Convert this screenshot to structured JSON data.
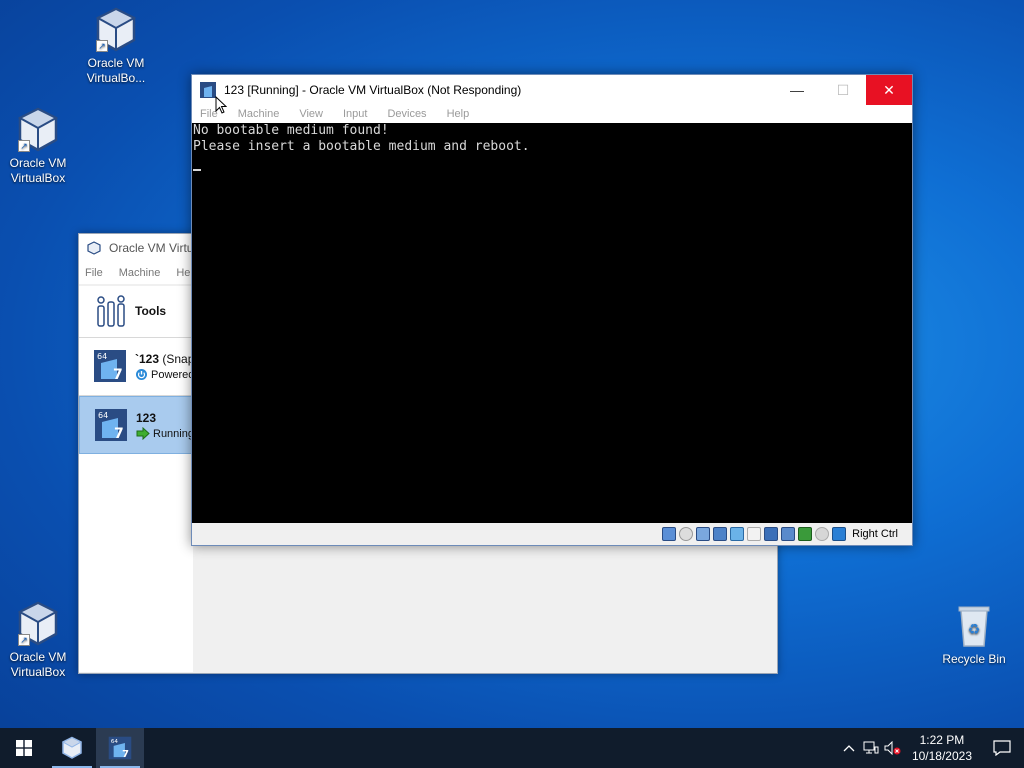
{
  "desktop": {
    "icons": [
      {
        "label": "Oracle VM VirtualBo..."
      },
      {
        "label": "Oracle VM VirtualBox"
      },
      {
        "label": "Oracle VM VirtualBox"
      },
      {
        "label": "Recycle Bin"
      }
    ]
  },
  "manager": {
    "title": "Oracle VM Virtu",
    "menu": [
      "File",
      "Machine",
      "Help"
    ],
    "tools_label": "Tools",
    "vms": [
      {
        "name": "`123",
        "name_suffix": " (Snap",
        "state": "Powered"
      },
      {
        "name": "123",
        "name_suffix": "",
        "state": "Running"
      }
    ]
  },
  "vm_window": {
    "title": "123 [Running] - Oracle VM VirtualBox (Not Responding)",
    "menu": [
      "File",
      "Machine",
      "View",
      "Input",
      "Devices",
      "Help"
    ],
    "console_lines": [
      "No bootable medium found!",
      "Please insert a bootable medium and reboot."
    ],
    "host_key": "Right Ctrl",
    "minimize_glyph": "—",
    "maximize_glyph": "☐",
    "close_glyph": "✕"
  },
  "taskbar": {
    "time": "1:22 PM",
    "date": "10/18/2023"
  },
  "colors": {
    "close_red": "#e81123",
    "selection_blue": "#a9cbee",
    "taskbar": "#101c2c"
  }
}
